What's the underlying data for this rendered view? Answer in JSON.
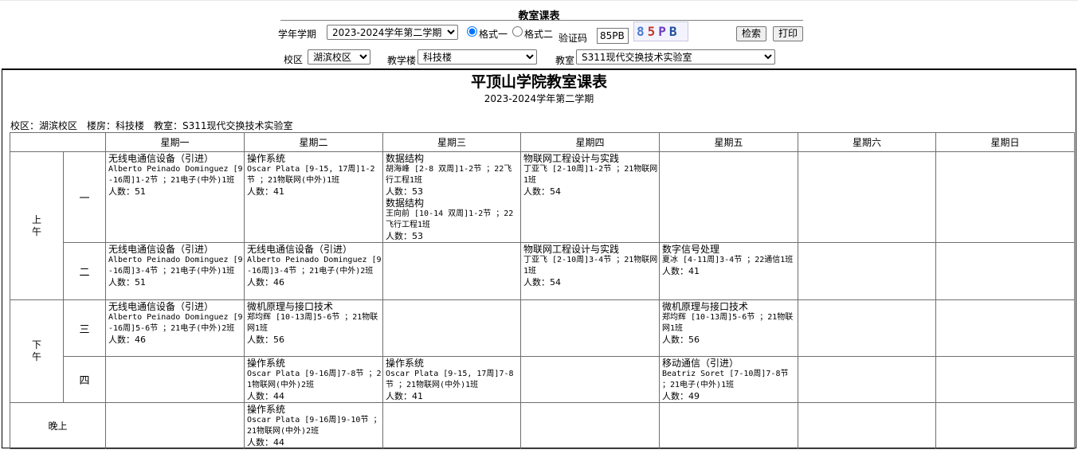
{
  "page_title": "教室课表",
  "form": {
    "term_label": "学年学期",
    "term_value": "2023-2024学年第二学期",
    "format1_label": "格式一",
    "format2_label": "格式二",
    "captcha_label": "验证码",
    "captcha_value": "85PB",
    "captcha_image_text": [
      "8",
      "5",
      "P",
      "B"
    ],
    "search_label": "检索",
    "print_label": "打印",
    "campus_label": "校区",
    "campus_value": "湖滨校区",
    "building_label": "教学楼",
    "building_value": "科技楼",
    "room_label": "教室",
    "room_value": "S311现代交换技术实验室"
  },
  "schedule": {
    "title": "平顶山学院教室课表",
    "term": "2023-2024学年第二学期",
    "info": "校区：湖滨校区　楼房：科技楼　教室：S311现代交换技术实验室",
    "days": [
      "星期一",
      "星期二",
      "星期三",
      "星期四",
      "星期五",
      "星期六",
      "星期日"
    ],
    "periods": {
      "morning": "上午",
      "afternoon": "下午",
      "evening": "晚上"
    },
    "slots": [
      "一",
      "二",
      "三",
      "四"
    ],
    "cells": {
      "s1_d1": [
        {
          "title": "无线电通信设备（引进）",
          "detail": "Alberto Peinado Dominguez [9-16周]1-2节 ；21电子(中外)1班",
          "count": "人数：51"
        }
      ],
      "s1_d2": [
        {
          "title": "操作系统",
          "detail": "Oscar Plata [9-15, 17周]1-2节 ；21物联网(中外)1班",
          "count": "人数：41"
        }
      ],
      "s1_d3": [
        {
          "title": "数据结构",
          "detail": "胡海峰 [2-8 双周]1-2节 ；22飞行工程1班",
          "count": "人数：53"
        },
        {
          "title": "数据结构",
          "detail": "王向前 [10-14 双周]1-2节 ；22飞行工程1班",
          "count": "人数：53"
        }
      ],
      "s1_d4": [
        {
          "title": "物联网工程设计与实践",
          "detail": "丁亚飞 [2-10周]1-2节 ；21物联网1班",
          "count": "人数：54"
        }
      ],
      "s2_d1": [
        {
          "title": "无线电通信设备（引进）",
          "detail": "Alberto Peinado Dominguez [9-16周]3-4节 ；21电子(中外)1班",
          "count": "人数：51"
        }
      ],
      "s2_d2": [
        {
          "title": "无线电通信设备（引进）",
          "detail": "Alberto Peinado Dominguez [9-16周]3-4节 ；21电子(中外)2班",
          "count": "人数：46"
        }
      ],
      "s2_d4": [
        {
          "title": "物联网工程设计与实践",
          "detail": "丁亚飞 [2-10周]3-4节 ；21物联网1班",
          "count": "人数：54"
        }
      ],
      "s2_d5": [
        {
          "title": "数字信号处理",
          "detail": "夏冰 [4-11周]3-4节 ；22通信1班",
          "count": "人数：41"
        }
      ],
      "s3_d1": [
        {
          "title": "无线电通信设备（引进）",
          "detail": "Alberto Peinado Dominguez [9-16周]5-6节 ；21电子(中外)2班",
          "count": "人数：46"
        }
      ],
      "s3_d2": [
        {
          "title": "微机原理与接口技术",
          "detail": "郑均辉 [10-13周]5-6节 ；21物联网1班",
          "count": "人数：56"
        }
      ],
      "s3_d5": [
        {
          "title": "微机原理与接口技术",
          "detail": "郑均辉 [10-13周]5-6节 ；21物联网1班",
          "count": "人数：56"
        }
      ],
      "s4_d2": [
        {
          "title": "操作系统",
          "detail": "Oscar Plata [9-16周]7-8节 ；21物联网(中外)2班",
          "count": "人数：44"
        }
      ],
      "s4_d3": [
        {
          "title": "操作系统",
          "detail": "Oscar Plata [9-15, 17周]7-8节 ；21物联网(中外)1班",
          "count": "人数：41"
        }
      ],
      "s4_d5": [
        {
          "title": "移动通信（引进）",
          "detail": "Beatriz Soret [7-10周]7-8节 ；21电子(中外)1班",
          "count": "人数：49"
        }
      ],
      "s5_d2": [
        {
          "title": "操作系统",
          "detail": "Oscar Plata [9-16周]9-10节 ；21物联网(中外)2班",
          "count": "人数：44"
        }
      ]
    }
  }
}
